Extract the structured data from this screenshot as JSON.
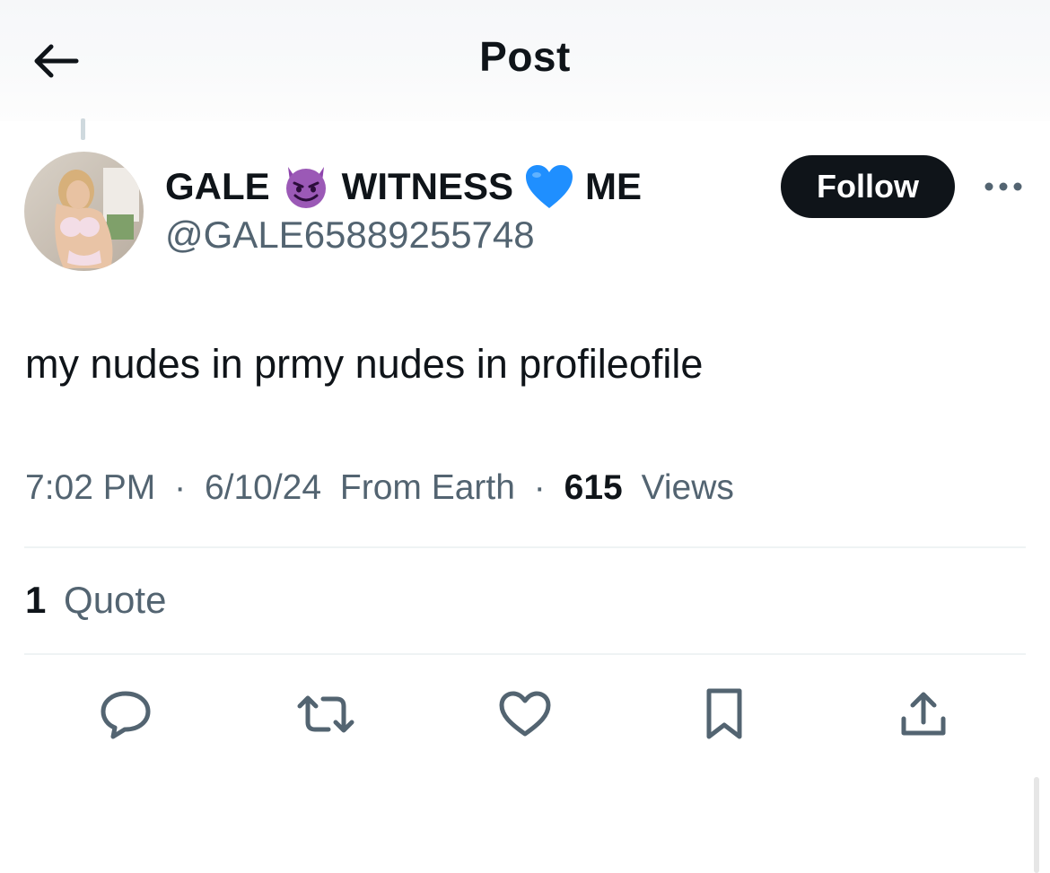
{
  "header": {
    "title": "Post",
    "back_icon": "arrow-left-icon"
  },
  "author": {
    "name_part1": "GALE",
    "name_part2": "WITNESS",
    "name_part3": "ME",
    "emoji1": "smiling-imp-emoji",
    "emoji2": "blue-heart-emoji",
    "handle": "@GALE65889255748",
    "follow_label": "Follow",
    "more_icon": "more-horizontal-icon"
  },
  "post": {
    "text": "my nudes in prmy nudes in profileofile",
    "time": "7:02 PM",
    "separator": "·",
    "date": "6/10/24",
    "location": "From Earth",
    "views_count": "615",
    "views_label": "Views"
  },
  "engagement": {
    "quote_count": "1",
    "quote_label": "Quote"
  },
  "actions": [
    "reply-icon",
    "repost-icon",
    "like-icon",
    "bookmark-icon",
    "share-icon"
  ],
  "colors": {
    "text_primary": "#0f1419",
    "text_secondary": "#536471",
    "divider": "#eff3f4",
    "follow_bg": "#0f1419",
    "follow_text": "#ffffff",
    "imp_purple": "#8e44ad",
    "heart_blue": "#1f8fff"
  }
}
